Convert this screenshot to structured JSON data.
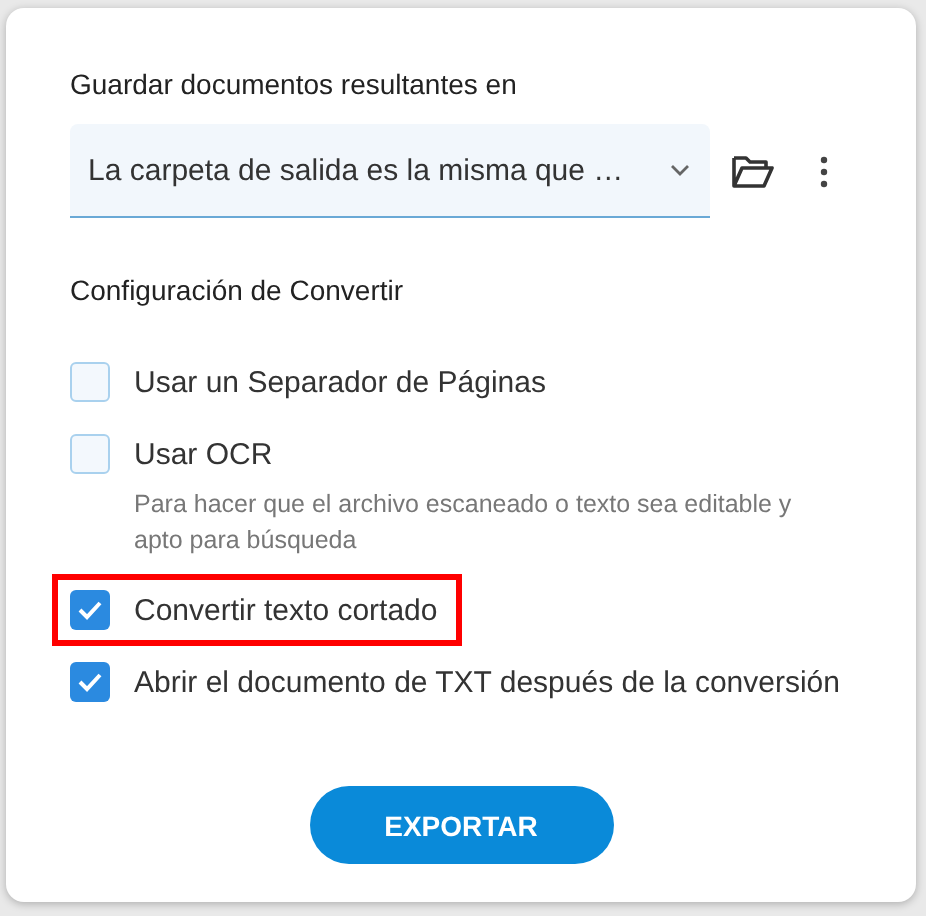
{
  "save_section": {
    "title": "Guardar documentos resultantes en",
    "folder_select": {
      "value": "La carpeta de salida es la misma que …"
    }
  },
  "convert_section": {
    "title": "Configuración de Convertir",
    "options": [
      {
        "label": "Usar un Separador de Páginas",
        "checked": false,
        "highlighted": false
      },
      {
        "label": "Usar OCR",
        "checked": false,
        "highlighted": false,
        "hint": "Para hacer que el archivo escaneado o texto sea editable y apto para búsqueda"
      },
      {
        "label": "Convertir texto cortado",
        "checked": true,
        "highlighted": true
      },
      {
        "label": "Abrir el documento de TXT después de la conversión",
        "checked": true,
        "highlighted": false
      }
    ]
  },
  "export_button": "EXPORTAR"
}
